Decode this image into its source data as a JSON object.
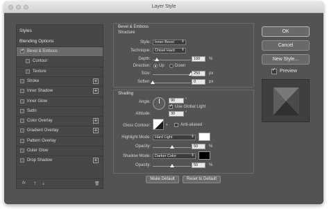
{
  "window": {
    "title": "Layer Style"
  },
  "left": {
    "styles_label": "Styles",
    "blending_label": "Blending Options",
    "items": [
      {
        "label": "Bevel & Emboss",
        "checked": true,
        "plus": false,
        "selected": true
      },
      {
        "label": "Contour",
        "checked": false,
        "plus": false
      },
      {
        "label": "Texture",
        "checked": false,
        "plus": false
      },
      {
        "label": "Stroke",
        "checked": false,
        "plus": true
      },
      {
        "label": "Inner Shadow",
        "checked": false,
        "plus": true
      },
      {
        "label": "Inner Glow",
        "checked": false,
        "plus": false
      },
      {
        "label": "Satin",
        "checked": false,
        "plus": false
      },
      {
        "label": "Color Overlay",
        "checked": false,
        "plus": true
      },
      {
        "label": "Gradient Overlay",
        "checked": false,
        "plus": true
      },
      {
        "label": "Pattern Overlay",
        "checked": false,
        "plus": false
      },
      {
        "label": "Outer Glow",
        "checked": false,
        "plus": false
      },
      {
        "label": "Drop Shadow",
        "checked": false,
        "plus": true
      }
    ],
    "footer": {
      "fx": "fx",
      "up": "⇡",
      "down": "⇣",
      "trash": "🗑"
    }
  },
  "structure": {
    "title": "Bevel & Emboss",
    "subtitle": "Structure",
    "style_label": "Style:",
    "style_value": "Inner Bevel",
    "technique_label": "Technique:",
    "technique_value": "Chisel Hard",
    "depth_label": "Depth:",
    "depth_value": "100",
    "depth_unit": "%",
    "depth_level": 0.1,
    "direction_label": "Direction:",
    "dir_up": "Up",
    "dir_down": "Down",
    "size_label": "Size:",
    "size_value": "250",
    "size_unit": "px",
    "size_level": 1.0,
    "soften_label": "Soften:",
    "soften_value": "0",
    "soften_unit": "px",
    "soften_level": 0.0
  },
  "shading": {
    "title": "Shading",
    "angle_label": "Angle:",
    "angle_value": "90",
    "angle_unit": "°",
    "global_light_label": "Use Global Light",
    "altitude_label": "Altitude:",
    "altitude_value": "30",
    "altitude_unit": "°",
    "gloss_label": "Gloss Contour:",
    "anti_aliased_label": "Anti-aliased",
    "highlight_label": "Highlight Mode:",
    "highlight_value": "Hard Light",
    "highlight_color": "#ffffff",
    "hl_opacity_label": "Opacity:",
    "hl_opacity_value": "50",
    "hl_opacity_unit": "%",
    "hl_opacity_level": 0.5,
    "shadow_label": "Shadow Mode:",
    "shadow_value": "Darker Color",
    "shadow_color": "#000000",
    "sh_opacity_label": "Opacity:",
    "sh_opacity_value": "50",
    "sh_opacity_unit": "%",
    "sh_opacity_level": 0.5
  },
  "buttons": {
    "make_default": "Make Default",
    "reset_default": "Reset to Default",
    "ok": "OK",
    "cancel": "Cancel",
    "new_style": "New Style...",
    "preview": "Preview"
  }
}
